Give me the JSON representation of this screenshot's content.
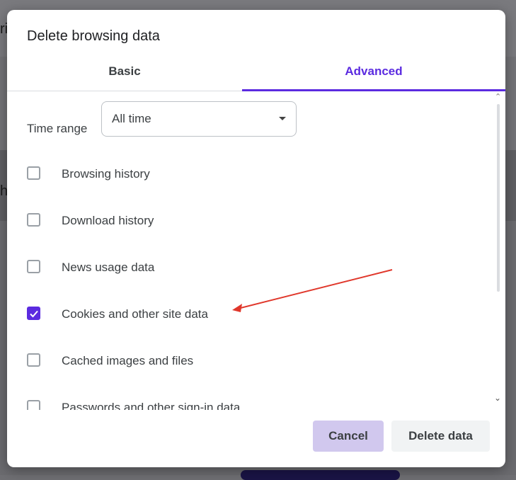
{
  "background": {
    "fragment_top": "ri",
    "fragment_mid": "h"
  },
  "dialog": {
    "title": "Delete browsing data",
    "tabs": [
      {
        "label": "Basic",
        "selected": false
      },
      {
        "label": "Advanced",
        "selected": true
      }
    ],
    "time_range": {
      "label": "Time range",
      "value": "All time"
    },
    "options": [
      {
        "label": "Browsing history",
        "checked": false
      },
      {
        "label": "Download history",
        "checked": false
      },
      {
        "label": "News usage data",
        "checked": false
      },
      {
        "label": "Cookies and other site data",
        "checked": true
      },
      {
        "label": "Cached images and files",
        "checked": false
      },
      {
        "label": "Passwords and other sign-in data",
        "checked": false
      }
    ],
    "buttons": {
      "cancel": "Cancel",
      "delete": "Delete data"
    }
  },
  "colors": {
    "accent": "#5b2be0",
    "cancel_bg": "#d1c8ee",
    "annotation_arrow": "#e0372b"
  },
  "icons": {
    "checkmark": "check-icon",
    "dropdown": "caret-down-icon",
    "arrow": "annotation-arrow"
  }
}
